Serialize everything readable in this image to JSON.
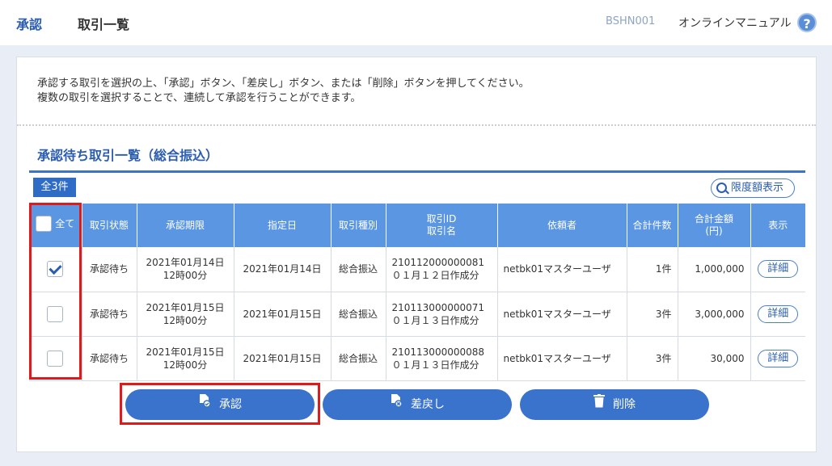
{
  "header": {
    "section": "承認",
    "title": "取引一覧",
    "screen_code": "BSHN001",
    "manual_link": "オンラインマニュアル",
    "help_icon_label": "?"
  },
  "intro": {
    "line1": "承認する取引を選択の上、「承認」ボタン、「差戻し」ボタン、または「削除」ボタンを押してください。",
    "line2": "複数の取引を選択することで、連続して承認を行うことができます。"
  },
  "section_title": "承認待ち取引一覧（総合振込）",
  "count_badge": "全3件",
  "limit_button": "限度額表示",
  "table": {
    "headers": {
      "select_all": "全て",
      "status": "取引状態",
      "deadline": "承認期限",
      "date": "指定日",
      "type": "取引種別",
      "id_name_1": "取引ID",
      "id_name_2": "取引名",
      "requester": "依頼者",
      "count": "合計件数",
      "amount_1": "合計金額",
      "amount_2": "(円)",
      "view": "表示"
    },
    "rows": [
      {
        "checked": true,
        "status": "承認待ち",
        "deadline_1": "2021年01月14日",
        "deadline_2": "12時00分",
        "date": "2021年01月14日",
        "type": "総合振込",
        "id": "210112000000081",
        "name": "０１月１２日作成分",
        "requester": "netbk01マスターユーザ",
        "count": "1件",
        "amount": "1,000,000",
        "detail": "詳細"
      },
      {
        "checked": false,
        "status": "承認待ち",
        "deadline_1": "2021年01月15日",
        "deadline_2": "12時00分",
        "date": "2021年01月15日",
        "type": "総合振込",
        "id": "210113000000071",
        "name": "０１月１３日作成分",
        "requester": "netbk01マスターユーザ",
        "count": "3件",
        "amount": "3,000,000",
        "detail": "詳細"
      },
      {
        "checked": false,
        "status": "承認待ち",
        "deadline_1": "2021年01月15日",
        "deadline_2": "12時00分",
        "date": "2021年01月15日",
        "type": "総合振込",
        "id": "210113000000088",
        "name": "０１月１３日作成分",
        "requester": "netbk01マスターユーザ",
        "count": "3件",
        "amount": "30,000",
        "detail": "詳細"
      }
    ]
  },
  "actions": {
    "approve": "承認",
    "return": "差戻し",
    "delete": "削除"
  },
  "icons": {
    "help": "help-icon",
    "limit": "magnifier-icon",
    "approve": "document-check-icon",
    "return": "document-cross-icon",
    "delete": "trash-icon"
  },
  "colors": {
    "brand_blue": "#2a5db0",
    "header_blue": "#5b96e2",
    "button_blue": "#3a73cc",
    "highlight_red": "#e01a1a"
  }
}
